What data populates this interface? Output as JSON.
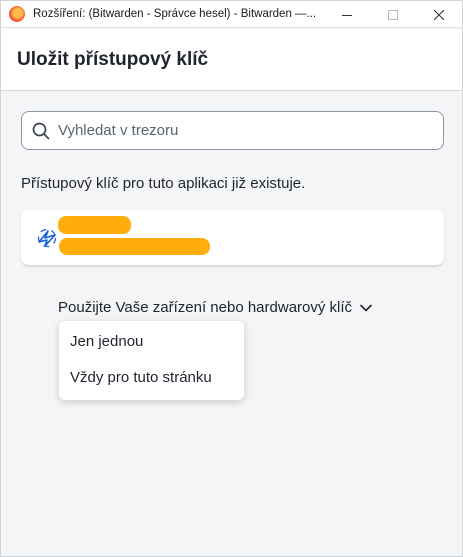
{
  "window": {
    "title": "Rozšíření: (Bitwarden - Správce hesel) - Bitwarden —...",
    "controls": [
      "minimize",
      "maximize",
      "close"
    ]
  },
  "header": {
    "title": "Uložit přístupový klíč"
  },
  "search": {
    "placeholder": "Vyhledat v trezoru",
    "value": ""
  },
  "notice": "Přístupový klíč pro tuto aplikaci již existuje.",
  "item": {
    "icon": "bitwarden-logo-icon",
    "name": "",
    "subtitle": "",
    "redacted": true
  },
  "options": {
    "trigger_label": "Použijte Vaše zařízení nebo hardwarový klíč",
    "items": [
      "Jen jednou",
      "Vždy pro tuto stránku"
    ]
  },
  "colors": {
    "accent": "#175ddc",
    "redaction": "#ffad0d",
    "text": "#1f242e"
  }
}
